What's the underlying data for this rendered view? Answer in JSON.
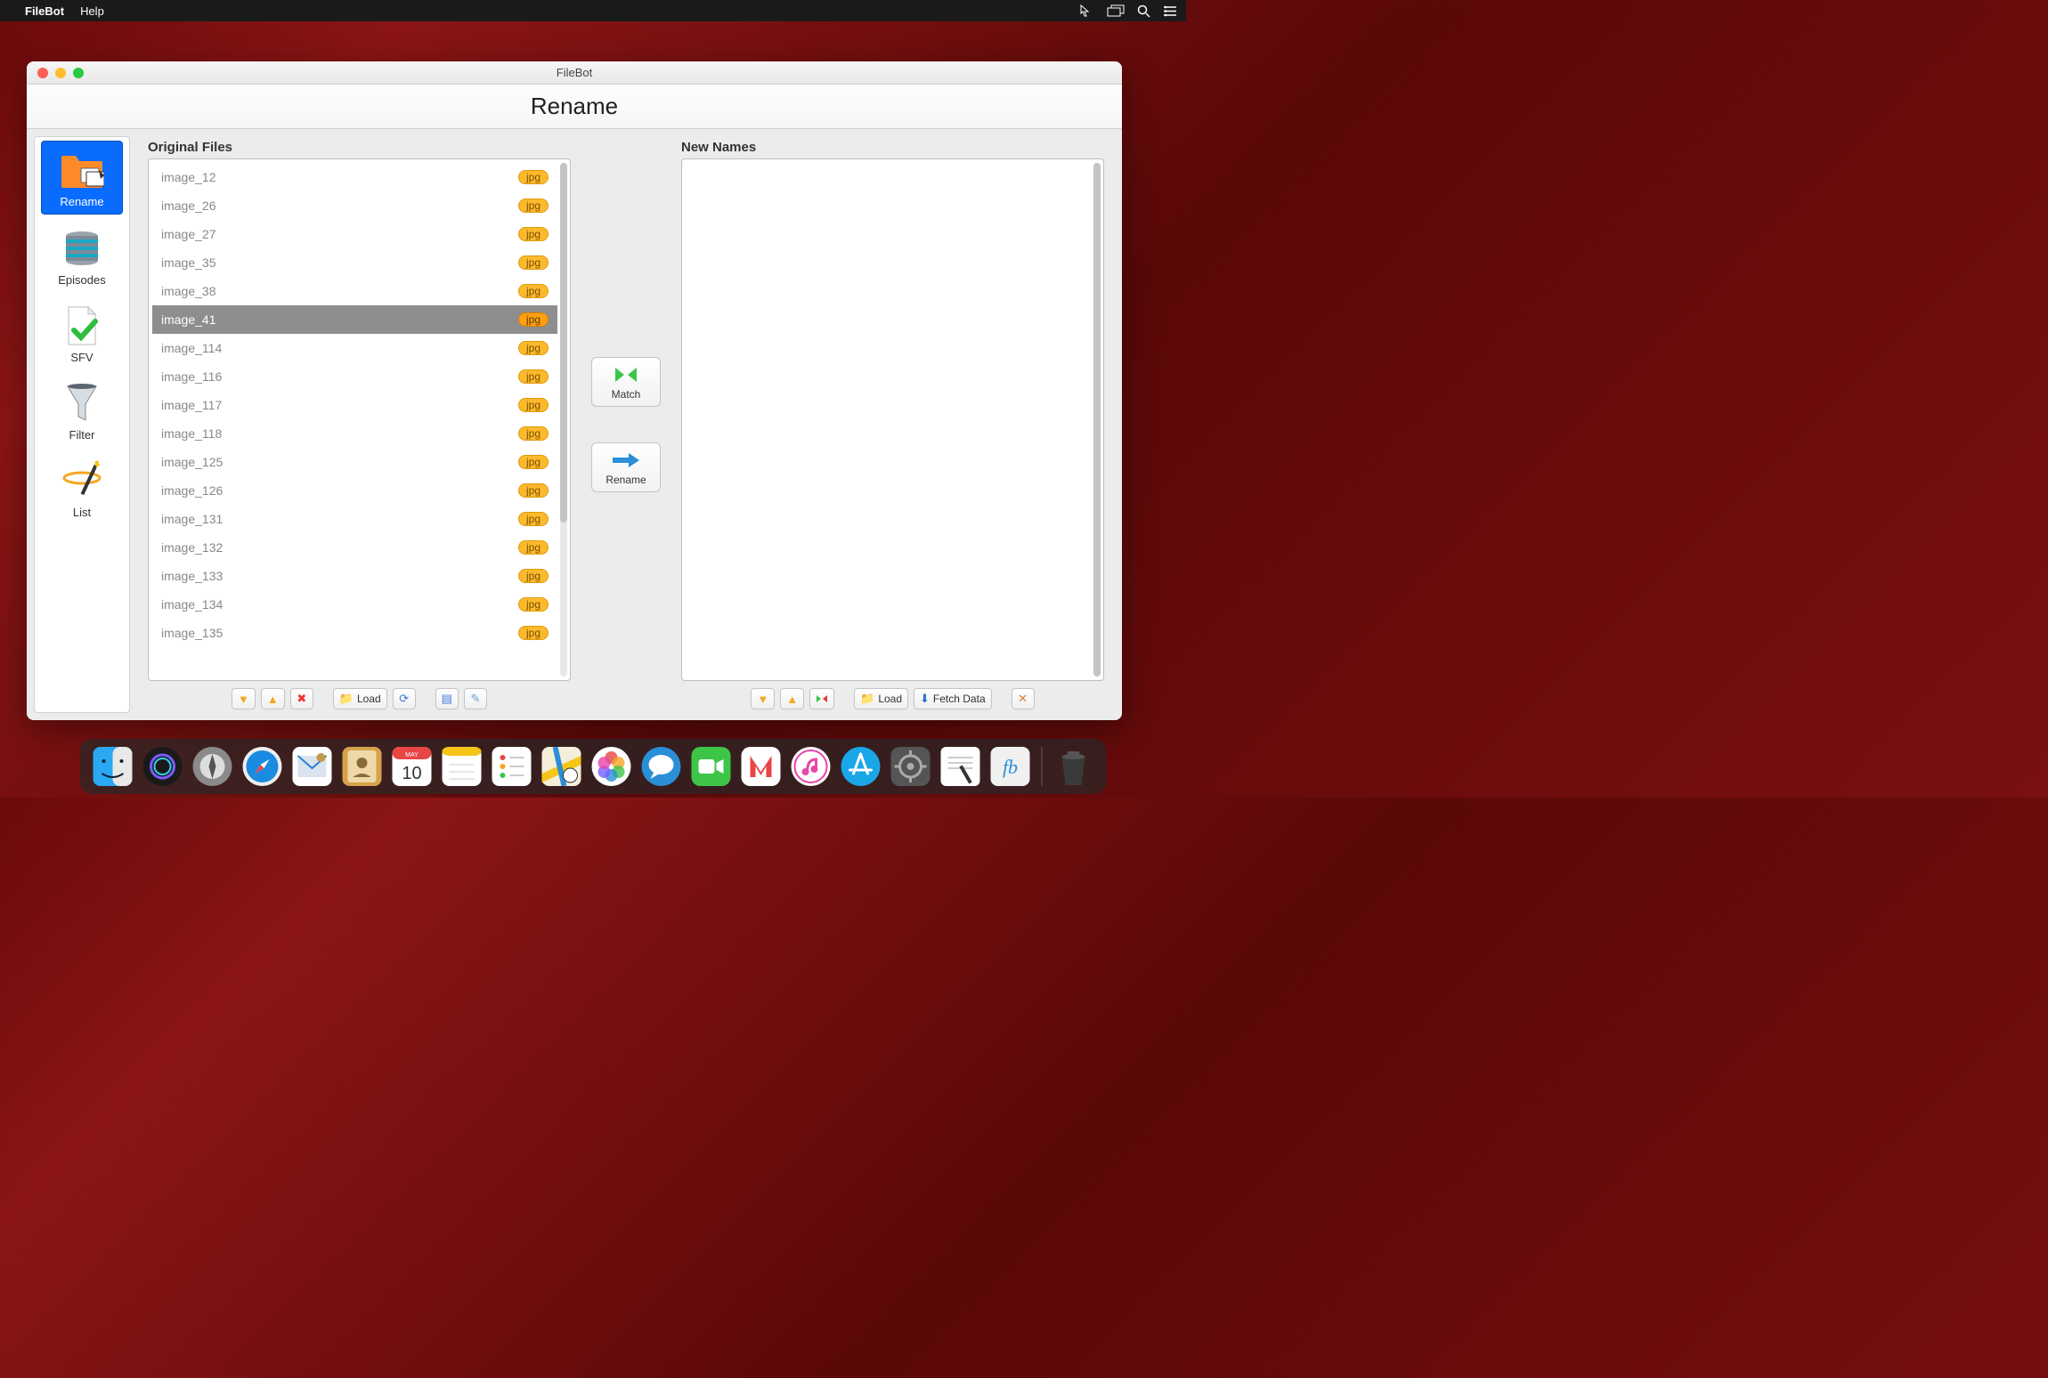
{
  "menubar": {
    "app": "FileBot",
    "items": [
      "Help"
    ]
  },
  "window": {
    "title": "FileBot",
    "header": "Rename"
  },
  "sidebar": {
    "items": [
      {
        "label": "Rename",
        "selected": true
      },
      {
        "label": "Episodes",
        "selected": false
      },
      {
        "label": "SFV",
        "selected": false
      },
      {
        "label": "Filter",
        "selected": false
      },
      {
        "label": "List",
        "selected": false
      }
    ]
  },
  "panels": {
    "original_label": "Original Files",
    "new_label": "New Names",
    "files": [
      {
        "name": "image_12",
        "ext": "jpg",
        "selected": false
      },
      {
        "name": "image_26",
        "ext": "jpg",
        "selected": false
      },
      {
        "name": "image_27",
        "ext": "jpg",
        "selected": false
      },
      {
        "name": "image_35",
        "ext": "jpg",
        "selected": false
      },
      {
        "name": "image_38",
        "ext": "jpg",
        "selected": false
      },
      {
        "name": "image_41",
        "ext": "jpg",
        "selected": true
      },
      {
        "name": "image_114",
        "ext": "jpg",
        "selected": false
      },
      {
        "name": "image_116",
        "ext": "jpg",
        "selected": false
      },
      {
        "name": "image_117",
        "ext": "jpg",
        "selected": false
      },
      {
        "name": "image_118",
        "ext": "jpg",
        "selected": false
      },
      {
        "name": "image_125",
        "ext": "jpg",
        "selected": false
      },
      {
        "name": "image_126",
        "ext": "jpg",
        "selected": false
      },
      {
        "name": "image_131",
        "ext": "jpg",
        "selected": false
      },
      {
        "name": "image_132",
        "ext": "jpg",
        "selected": false
      },
      {
        "name": "image_133",
        "ext": "jpg",
        "selected": false
      },
      {
        "name": "image_134",
        "ext": "jpg",
        "selected": false
      },
      {
        "name": "image_135",
        "ext": "jpg",
        "selected": false
      }
    ]
  },
  "center": {
    "match": "Match",
    "rename": "Rename"
  },
  "toolbar_left": {
    "load": "Load"
  },
  "toolbar_right": {
    "load": "Load",
    "fetch": "Fetch Data"
  },
  "dock": {
    "date_month": "MAY",
    "date_day": "10",
    "fb": "fb"
  }
}
